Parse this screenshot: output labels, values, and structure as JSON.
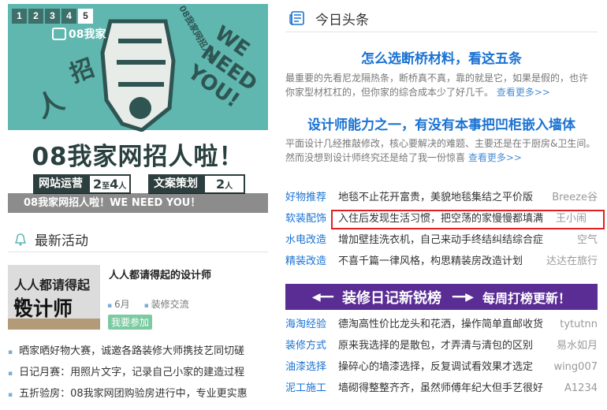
{
  "banner": {
    "pager": [
      "1",
      "2",
      "3",
      "4",
      "5"
    ],
    "logo": "08我家",
    "deco_words": [
      "WE NEED YOU!",
      "08我家网招人啦",
      "招",
      "人"
    ],
    "title": "08我家网招人啦！",
    "tags": [
      {
        "name": "网站运营",
        "count": "2",
        "unit": "至",
        "count2": "4",
        "unit2": "人"
      },
      {
        "name": "文案策划",
        "count": "2",
        "unit": "人"
      }
    ],
    "caption": "08我家网招人啦！WE NEED YOU！"
  },
  "activity": {
    "section_title": "最新活动",
    "event": {
      "thumb_line1": "人人都请得起的",
      "thumb_line2": "设计师",
      "title": "人人都请得起的设计师",
      "month": "6月",
      "category": "装修交流",
      "join_label": "我要参加"
    },
    "list": [
      "晒家晒好物大赛，诚邀各路装修大师携技艺同切磋",
      "日记月赛：用照片文字，记录自己小家的建造过程",
      "五折验房：08我家网团购验房进行中，专业更实惠"
    ]
  },
  "headlines": {
    "section_title": "今日头条",
    "items": [
      {
        "title": "怎么选断桥材料，看这五条",
        "summary_line1": "最重要的先看尼龙隔热条，断桥真不真，靠的就是它，如果是假的，也许",
        "summary_line2": "你家型材杠杠的，但你家的综合成本少了好几千。",
        "more": "查看更多>>"
      },
      {
        "title": "设计师能力之一，有没有本事把凹柜嵌入墙体",
        "summary_line1": "平面设计几经推敲修改，核心要解决的难题、主要还是在于厨房&卫生间。",
        "summary_line2": "然而没想到设计师终究还是给了我一份惊喜",
        "more": "查看更多>>"
      }
    ]
  },
  "feed_a": [
    {
      "cat": "好物推荐",
      "text": "地毯不止花开富贵，美貌地毯集结之平价版",
      "author": "Breeze谷"
    },
    {
      "cat": "软装配饰",
      "text": "入住后发现生活习惯，把空荡的家慢慢都填满",
      "author": "王小闹"
    },
    {
      "cat": "水电改造",
      "text": "增加壁挂洗衣机，自己来动手终结纠结综合症",
      "author": "空气"
    },
    {
      "cat": "精装改造",
      "text": "不喜千篇一律风格，构思精装房改造计划",
      "author": "达达在旅行"
    }
  ],
  "promo": {
    "main": "装修日记新锐榜",
    "sub": "每周打榜更新！",
    "arrow_left": "◀━━━",
    "arrow_right": "━━━▶"
  },
  "feed_b": [
    {
      "cat": "海淘经验",
      "text": "德淘高性价比龙头和花洒，操作简单直邮收货",
      "author": "tytutnn"
    },
    {
      "cat": "装修方式",
      "text": "原来我选择的是散包，才弄清与清包的区别",
      "author": "易水如月"
    },
    {
      "cat": "油漆选择",
      "text": "操碎心的墙漆选择，反复调试看效果才选定",
      "author": "wing007"
    },
    {
      "cat": "泥工施工",
      "text": "墙砌得整整齐齐，虽然师傅年纪大但手艺很好",
      "author": "A1234"
    }
  ],
  "colors": {
    "teal": "#5fb7b0",
    "link": "#1a72d2",
    "highlight_border": "#e02020",
    "promo_bg": "#5a2d95"
  }
}
